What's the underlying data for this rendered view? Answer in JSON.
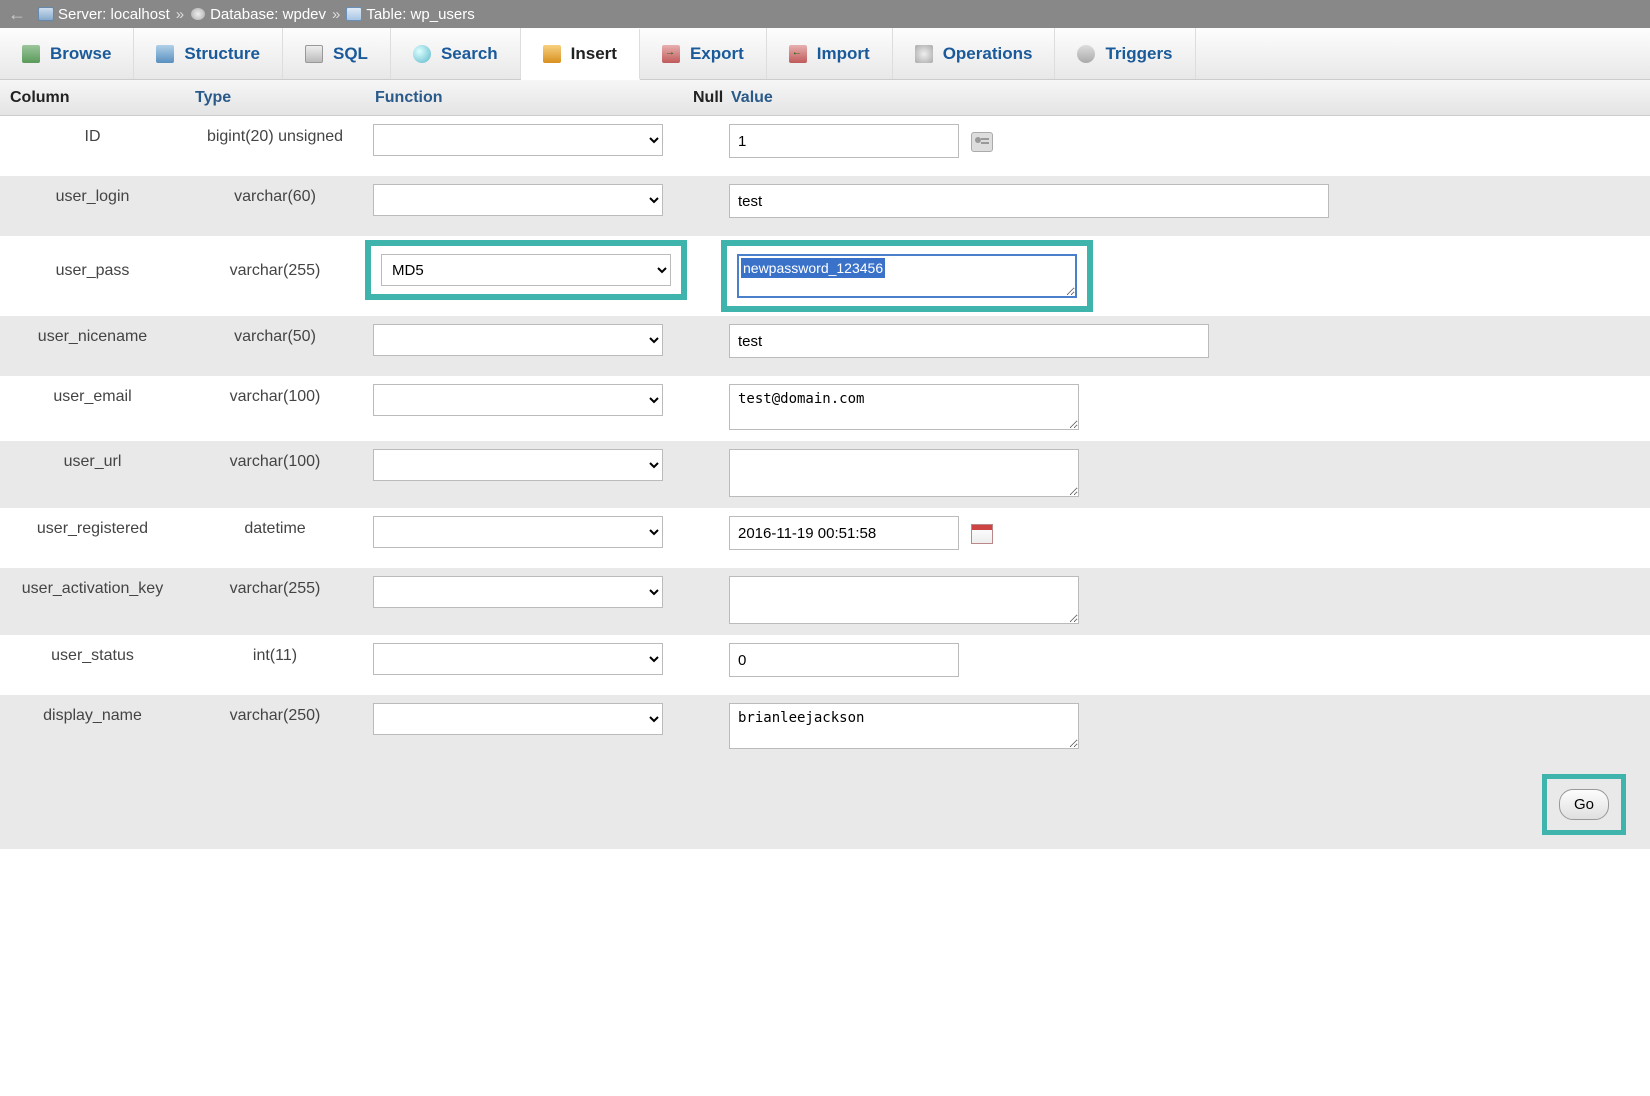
{
  "breadcrumb": {
    "server_label": "Server:",
    "server_name": "localhost",
    "database_label": "Database:",
    "database_name": "wpdev",
    "table_label": "Table:",
    "table_name": "wp_users"
  },
  "tabs": {
    "browse": "Browse",
    "structure": "Structure",
    "sql": "SQL",
    "search": "Search",
    "insert": "Insert",
    "export": "Export",
    "import": "Import",
    "operations": "Operations",
    "triggers": "Triggers"
  },
  "headers": {
    "column": "Column",
    "type": "Type",
    "function": "Function",
    "null": "Null",
    "value": "Value"
  },
  "rows": [
    {
      "column": "ID",
      "type": "bigint(20) unsigned",
      "func": "",
      "value": "1"
    },
    {
      "column": "user_login",
      "type": "varchar(60)",
      "func": "",
      "value": "test"
    },
    {
      "column": "user_pass",
      "type": "varchar(255)",
      "func": "MD5",
      "value": "newpassword_123456"
    },
    {
      "column": "user_nicename",
      "type": "varchar(50)",
      "func": "",
      "value": "test"
    },
    {
      "column": "user_email",
      "type": "varchar(100)",
      "func": "",
      "value": "test@domain.com"
    },
    {
      "column": "user_url",
      "type": "varchar(100)",
      "func": "",
      "value": ""
    },
    {
      "column": "user_registered",
      "type": "datetime",
      "func": "",
      "value": "2016-11-19 00:51:58"
    },
    {
      "column": "user_activation_key",
      "type": "varchar(255)",
      "func": "",
      "value": ""
    },
    {
      "column": "user_status",
      "type": "int(11)",
      "func": "",
      "value": "0"
    },
    {
      "column": "display_name",
      "type": "varchar(250)",
      "func": "",
      "value": "brianleejackson"
    }
  ],
  "go_label": "Go"
}
